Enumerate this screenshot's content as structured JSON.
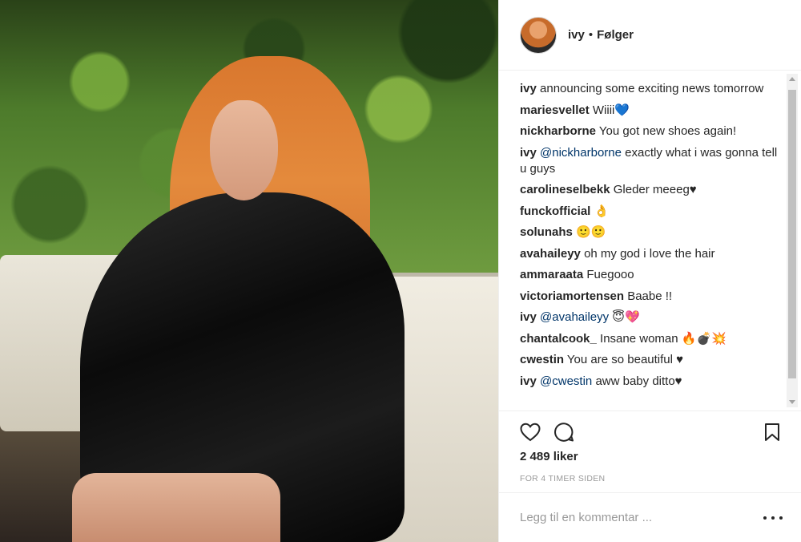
{
  "post": {
    "username": "ivy",
    "separator": "•",
    "follow_label": "Følger",
    "likes": "2 489 liker",
    "timestamp": "FOR 4 TIMER SIDEN"
  },
  "comments": [
    {
      "user": "ivy",
      "text": " announcing some exciting news tomorrow",
      "mention": ""
    },
    {
      "user": "mariesvellet",
      "text": " Wiiii💙",
      "mention": ""
    },
    {
      "user": "nickharborne",
      "text": " You got new shoes again!",
      "mention": ""
    },
    {
      "user": "ivy",
      "mention": "@nickharborne",
      "text": " exactly what i was gonna tell u guys"
    },
    {
      "user": "carolineselbekk",
      "text": " Gleder meeeg♥",
      "mention": ""
    },
    {
      "user": "funckofficial",
      "text": " 👌",
      "mention": ""
    },
    {
      "user": "solunahs",
      "text": " 🙂🙂",
      "mention": ""
    },
    {
      "user": "avahaileyy",
      "text": " oh my god i love the hair",
      "mention": ""
    },
    {
      "user": "ammaraata",
      "text": " Fuegooo",
      "mention": ""
    },
    {
      "user": "victoriamortensen",
      "text": " Baabe !!",
      "mention": ""
    },
    {
      "user": "ivy",
      "mention": "@avahaileyy",
      "text": " 😇💖"
    },
    {
      "user": "chantalcook_",
      "text": " Insane woman 🔥💣💥",
      "mention": ""
    },
    {
      "user": "cwestin",
      "text": " You are so beautiful ♥",
      "mention": ""
    },
    {
      "user": "ivy",
      "mention": "@cwestin",
      "text": " aww baby ditto♥"
    }
  ],
  "add_comment": {
    "placeholder": "Legg til en kommentar ..."
  },
  "icons": {
    "like": "heart-icon",
    "comment": "comment-bubble-icon",
    "save": "bookmark-icon",
    "more": "more-options-icon"
  },
  "colors": {
    "mention": "#003569",
    "text": "#262626",
    "muted": "#999999"
  }
}
